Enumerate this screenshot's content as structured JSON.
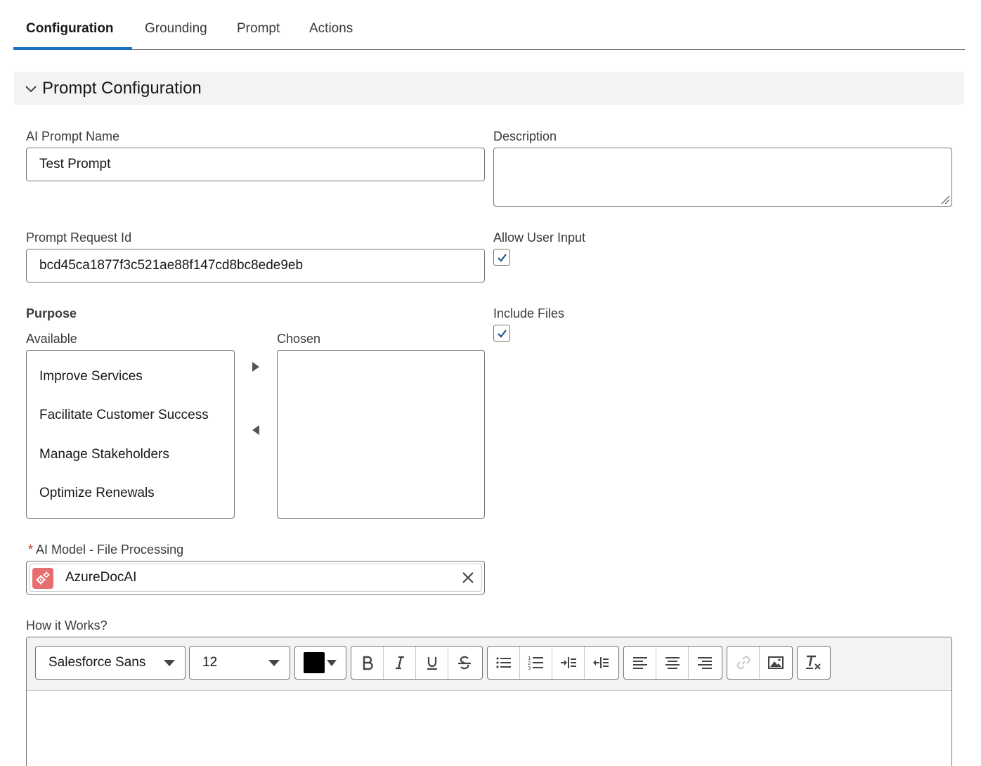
{
  "tabs": [
    {
      "label": "Configuration",
      "active": true
    },
    {
      "label": "Grounding",
      "active": false
    },
    {
      "label": "Prompt",
      "active": false
    },
    {
      "label": "Actions",
      "active": false
    }
  ],
  "section": {
    "title": "Prompt Configuration",
    "expanded": true
  },
  "fields": {
    "ai_prompt_name": {
      "label": "AI Prompt Name",
      "value": "Test Prompt"
    },
    "description": {
      "label": "Description",
      "value": ""
    },
    "prompt_request_id": {
      "label": "Prompt Request Id",
      "value": "bcd45ca1877f3c521ae88f147cd8bc8ede9eb"
    },
    "allow_user_input": {
      "label": "Allow User Input",
      "checked": true
    },
    "include_files": {
      "label": "Include Files",
      "checked": true
    }
  },
  "purpose": {
    "label": "Purpose",
    "available_label": "Available",
    "chosen_label": "Chosen",
    "available": [
      "Improve Services",
      "Facilitate Customer Success",
      "Manage Stakeholders",
      "Optimize Renewals"
    ],
    "chosen": []
  },
  "ai_model": {
    "required_mark": "*",
    "label": "AI Model - File Processing",
    "value": "AzureDocAI",
    "icon": "gears-icon"
  },
  "how_it_works": {
    "label": "How it Works?",
    "font_family": "Salesforce Sans",
    "font_size": "12",
    "text_color": "#000000"
  },
  "colors": {
    "accent": "#1b6fc6",
    "checkbox_check": "#1b5297",
    "lookup_icon_bg": "#e66e6e",
    "required": "#c23934"
  }
}
